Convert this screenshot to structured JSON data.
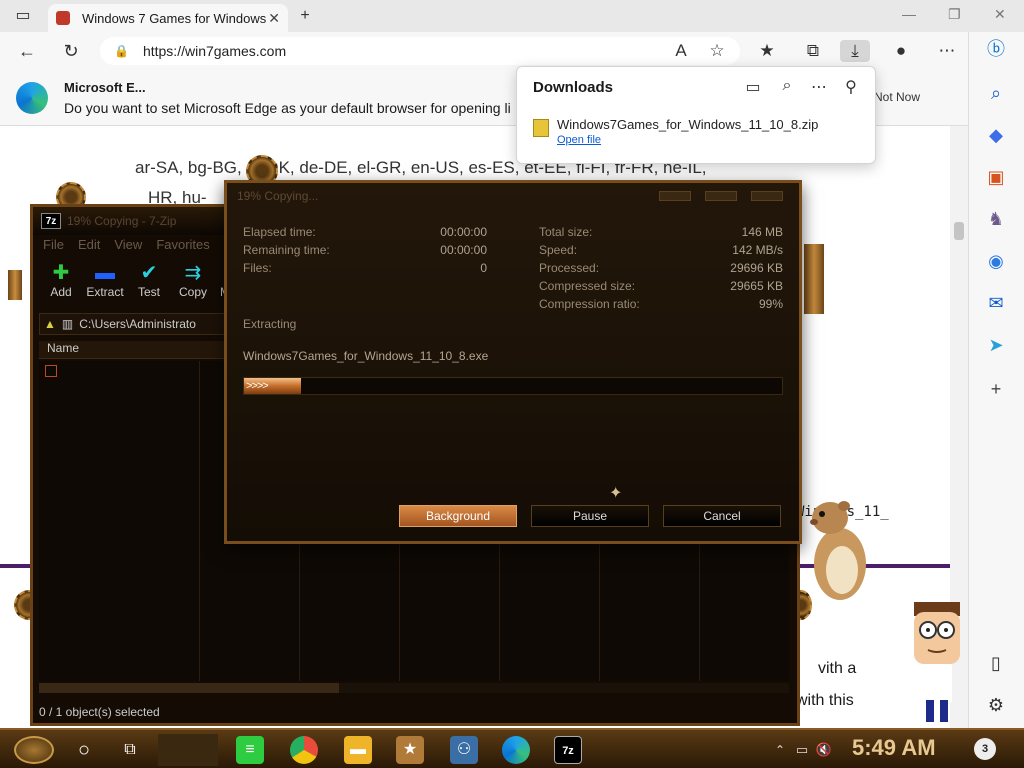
{
  "browser": {
    "tab_title": "Windows 7 Games for Windows",
    "url": "https://win7games.com"
  },
  "notification": {
    "title": "Microsoft E...",
    "message": "Do you want to set Microsoft Edge as your default browser for opening li",
    "not_now": "Not Now"
  },
  "downloads": {
    "header": "Downloads",
    "file_name": "Windows7Games_for_Windows_11_10_8.zip",
    "open_file": "Open file"
  },
  "page": {
    "lang_line1": "ar-SA, bg-BG, ...-DK, de-DE, el-GR, en-US, es-ES, et-EE, fi-FI, fr-FR, he-IL,",
    "lang_line2": "HR, hu-",
    "file_fragment": "Windows_11_",
    "with_a": "vith a",
    "with_this": "with  this"
  },
  "zipwin": {
    "logo": "7z",
    "title": "19% Copying - 7-Zip",
    "menu": [
      "File",
      "Edit",
      "View",
      "Favorites"
    ],
    "toolbar": [
      "Add",
      "Extract",
      "Test",
      "Copy",
      "M"
    ],
    "path": "C:\\Users\\Administrato",
    "col_name": "Name",
    "status": "0 / 1 object(s) selected"
  },
  "dialog": {
    "title": "19% Copying...",
    "elapsed_label": "Elapsed time:",
    "elapsed_value": "00:00:00",
    "remaining_label": "Remaining time:",
    "remaining_value": "00:00:00",
    "files_label": "Files:",
    "files_value": "0",
    "total_label": "Total size:",
    "total_value": "146 MB",
    "speed_label": "Speed:",
    "speed_value": "142 MB/s",
    "processed_label": "Processed:",
    "processed_value": "29696 KB",
    "compressed_label": "Compressed size:",
    "compressed_value": "29665 KB",
    "ratio_label": "Compression ratio:",
    "ratio_value": "99%",
    "extracting_label": "Extracting",
    "current_file": "Windows7Games_for_Windows_11_10_8.exe",
    "progress_glyphs": ">>>>",
    "progress": 0.19,
    "btn_background": "Background",
    "btn_pause": "Pause",
    "btn_cancel": "Cancel"
  },
  "taskbar": {
    "clock": "5:49 AM",
    "notifications": "3"
  },
  "colors": {
    "accent": "#0b5cd1",
    "steampunk_brown": "#7a4d1c",
    "progress_orange": "#c56d2a",
    "purple_rule": "#4b1d6b"
  }
}
